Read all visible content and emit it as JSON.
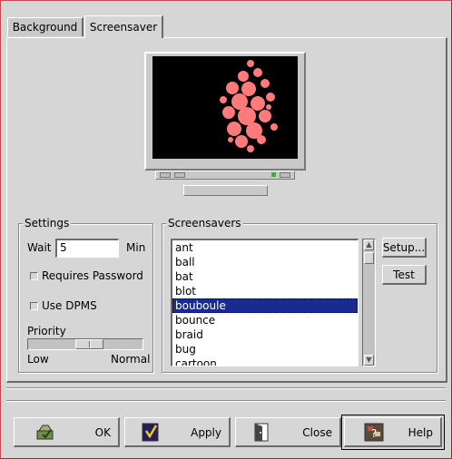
{
  "tabs": [
    {
      "label": "Background",
      "active": false
    },
    {
      "label": "Screensaver",
      "active": true
    }
  ],
  "preview": {
    "screen_color": "#000000",
    "blob_color": "#ff7a7a"
  },
  "settings": {
    "title": "Settings",
    "wait_label": "Wait",
    "wait_value": "5",
    "wait_unit": "Min",
    "requires_password_label": "Requires Password",
    "requires_password_checked": false,
    "use_dpms_label": "Use DPMS",
    "use_dpms_checked": false,
    "priority_label": "Priority",
    "priority_value": 0.55,
    "priority_low": "Low",
    "priority_high": "Normal"
  },
  "screensavers": {
    "title": "Screensavers",
    "items": [
      "ant",
      "ball",
      "bat",
      "blot",
      "bouboule",
      "bounce",
      "braid",
      "bug",
      "cartoon"
    ],
    "selected": "bouboule",
    "setup_label": "Setup...",
    "test_label": "Test"
  },
  "actions": {
    "ok_label": "OK",
    "apply_label": "Apply",
    "close_label": "Close",
    "help_label": "Help"
  },
  "colors": {
    "selection": "#1a2b8f",
    "background": "#d6d6d6"
  }
}
